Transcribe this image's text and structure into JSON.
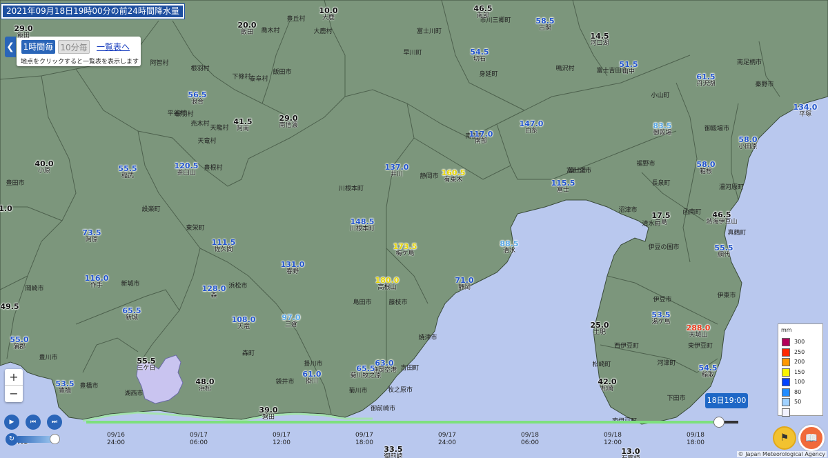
{
  "title": "2021年09月18日19時00分の前24時間降水量",
  "panel": {
    "hourly_label": "1時間毎",
    "tenmin_label": "10分毎",
    "list_link": "一覧表へ",
    "hint": "地点をクリックすると一覧表を表示します"
  },
  "stations": [
    {
      "v": "29.0",
      "n": "飯田",
      "c": "#111"
    },
    {
      "v": "10.0",
      "n": "大鹿",
      "c": "#111"
    },
    {
      "v": "20.0",
      "n": "飯田",
      "c": "#111"
    },
    {
      "v": "46.5",
      "n": "南部",
      "c": "#111"
    },
    {
      "v": "58.5",
      "n": "古関",
      "c": "#2255cc"
    },
    {
      "v": "14.5",
      "n": "河口湖",
      "c": "#111"
    },
    {
      "v": "54.5",
      "n": "切石",
      "c": "#2255cc"
    },
    {
      "v": "51.5",
      "n": "山中",
      "c": "#2255cc"
    },
    {
      "v": "61.5",
      "n": "丹沢湖",
      "c": "#2255cc"
    },
    {
      "v": "56.5",
      "n": "浪合",
      "c": "#2255cc"
    },
    {
      "v": "41.5",
      "n": "阿南",
      "c": "#111"
    },
    {
      "v": "29.0",
      "n": "南信濃",
      "c": "#111"
    },
    {
      "v": "147.0",
      "n": "白糸",
      "c": "#2255cc"
    },
    {
      "v": "83.5",
      "n": "御殿場",
      "c": "#5aa8e6"
    },
    {
      "v": "134.0",
      "n": "平塚",
      "c": "#2255cc"
    },
    {
      "v": "117.0",
      "n": "南部",
      "c": "#2255cc"
    },
    {
      "v": "58.0",
      "n": "小田原",
      "c": "#2255cc"
    },
    {
      "v": "40.0",
      "n": "小原",
      "c": "#111"
    },
    {
      "v": "55.5",
      "n": "稲武",
      "c": "#2255cc"
    },
    {
      "v": "120.5",
      "n": "茶臼山",
      "c": "#2255cc"
    },
    {
      "v": "137.0",
      "n": "井川",
      "c": "#2255cc"
    },
    {
      "v": "160.5",
      "n": "有東木",
      "c": "#e6d400"
    },
    {
      "v": "58.0",
      "n": "箱根",
      "c": "#2255cc"
    },
    {
      "v": "115.5",
      "n": "富士",
      "c": "#2255cc"
    },
    {
      "v": "1.0",
      "n": "",
      "c": "#111"
    },
    {
      "v": "17.5",
      "n": "三島",
      "c": "#111"
    },
    {
      "v": "46.5",
      "n": "熱海伊豆山",
      "c": "#111"
    },
    {
      "v": "73.5",
      "n": "阿原",
      "c": "#2255cc"
    },
    {
      "v": "148.5",
      "n": "川根本町",
      "c": "#2255cc"
    },
    {
      "v": "111.5",
      "n": "佐久間",
      "c": "#2255cc"
    },
    {
      "v": "173.5",
      "n": "梅ケ島",
      "c": "#e6d400"
    },
    {
      "v": "88.5",
      "n": "清水",
      "c": "#5aa8e6"
    },
    {
      "v": "55.5",
      "n": "網代",
      "c": "#2255cc"
    },
    {
      "v": "131.0",
      "n": "春野",
      "c": "#2255cc"
    },
    {
      "v": "116.0",
      "n": "作手",
      "c": "#2255cc"
    },
    {
      "v": "180.0",
      "n": "高根山",
      "c": "#e6d400"
    },
    {
      "v": "71.0",
      "n": "静岡",
      "c": "#2255cc"
    },
    {
      "v": "128.0",
      "n": "森",
      "c": "#2255cc"
    },
    {
      "v": "49.5",
      "n": "",
      "c": "#111"
    },
    {
      "v": "65.5",
      "n": "新城",
      "c": "#2255cc"
    },
    {
      "v": "108.0",
      "n": "天竜",
      "c": "#2255cc"
    },
    {
      "v": "97.0",
      "n": "三倉",
      "c": "#5aa8e6"
    },
    {
      "v": "53.5",
      "n": "湯ケ島",
      "c": "#2255cc"
    },
    {
      "v": "25.0",
      "n": "土肥",
      "c": "#111"
    },
    {
      "v": "288.0",
      "n": "天城山",
      "c": "#e83c1c"
    },
    {
      "v": "55.0",
      "n": "蒲郡",
      "c": "#2255cc"
    },
    {
      "v": "55.5",
      "n": "三ケ日",
      "c": "#111"
    },
    {
      "v": "63.0",
      "n": "静岡空港",
      "c": "#2255cc"
    },
    {
      "v": "65.5",
      "n": "菊川牧之原",
      "c": "#2255cc"
    },
    {
      "v": "61.0",
      "n": "掛川",
      "c": "#2255cc"
    },
    {
      "v": "54.5",
      "n": "稲取",
      "c": "#2255cc"
    },
    {
      "v": "53.5",
      "n": "豊橋",
      "c": "#2255cc"
    },
    {
      "v": "48.0",
      "n": "浜松",
      "c": "#111"
    },
    {
      "v": "42.0",
      "n": "松崎",
      "c": "#111"
    },
    {
      "v": "39.0",
      "n": "磐田",
      "c": "#111"
    },
    {
      "v": "33.5",
      "n": "御前崎",
      "c": "#111"
    },
    {
      "v": "13.0",
      "n": "石廊崎",
      "c": "#111"
    },
    {
      "v": "54.5",
      "n": "",
      "c": "#111"
    }
  ],
  "municipalities": [
    "大鹿村",
    "喬木村",
    "豊丘村",
    "富士川町",
    "市川三郷町",
    "阿智村",
    "根羽村",
    "下條村",
    "泰阜村",
    "飯田市",
    "早川町",
    "身延町",
    "鳴沢村",
    "富士吉田市",
    "平谷村",
    "売木村",
    "天龍村",
    "南部町",
    "富士宮市",
    "御殿場市",
    "南足柄市",
    "秦野市",
    "小山町",
    "根羽村",
    "天竜村",
    "豊根村",
    "設楽町",
    "東栄町",
    "川根本町",
    "静岡市",
    "富士市",
    "裾野市",
    "長泉町",
    "沼津市",
    "函南町",
    "清水町",
    "湯河原町",
    "真鶴町",
    "伊豆の国市",
    "伊東市",
    "豊田市",
    "岡崎市",
    "新城市",
    "浜松市",
    "島田市",
    "藤枝市",
    "焼津市",
    "吉田町",
    "牧之原市",
    "菊川市",
    "袋井市",
    "掛川市",
    "森町",
    "湖西市",
    "豊川市",
    "豊橋市",
    "伊豆市",
    "西伊豆町",
    "河津町",
    "東伊豆町",
    "下田市",
    "南伊豆町",
    "松崎町",
    "御前崎市"
  ],
  "legend": {
    "unit": "mm",
    "items": [
      {
        "label": "300",
        "color": "#b4005a"
      },
      {
        "label": "250",
        "color": "#ff2800"
      },
      {
        "label": "200",
        "color": "#ff9900"
      },
      {
        "label": "150",
        "color": "#faf500"
      },
      {
        "label": "100",
        "color": "#0041ff"
      },
      {
        "label": "80",
        "color": "#218cff"
      },
      {
        "label": "50",
        "color": "#a0d2ff"
      },
      {
        "label": "",
        "color": "#f2f2ff"
      }
    ]
  },
  "timeline": {
    "current": "18日19:00",
    "ticks": [
      {
        "d": "09/16",
        "t": "24:00"
      },
      {
        "d": "09/17",
        "t": "06:00"
      },
      {
        "d": "09/17",
        "t": "12:00"
      },
      {
        "d": "09/17",
        "t": "18:00"
      },
      {
        "d": "09/17",
        "t": "24:00"
      },
      {
        "d": "09/18",
        "t": "06:00"
      },
      {
        "d": "09/18",
        "t": "12:00"
      },
      {
        "d": "09/18",
        "t": "18:00"
      }
    ],
    "progress": 0.97
  },
  "copyright": "© Japan Meteorological Agency",
  "icons": {
    "play": "play-icon",
    "prev": "skip-back-icon",
    "next": "skip-forward-icon",
    "speed": "speed-icon",
    "zoom_in": "plus-icon",
    "zoom_out": "minus-icon",
    "help": "help-person-icon",
    "manual": "book-icon"
  }
}
